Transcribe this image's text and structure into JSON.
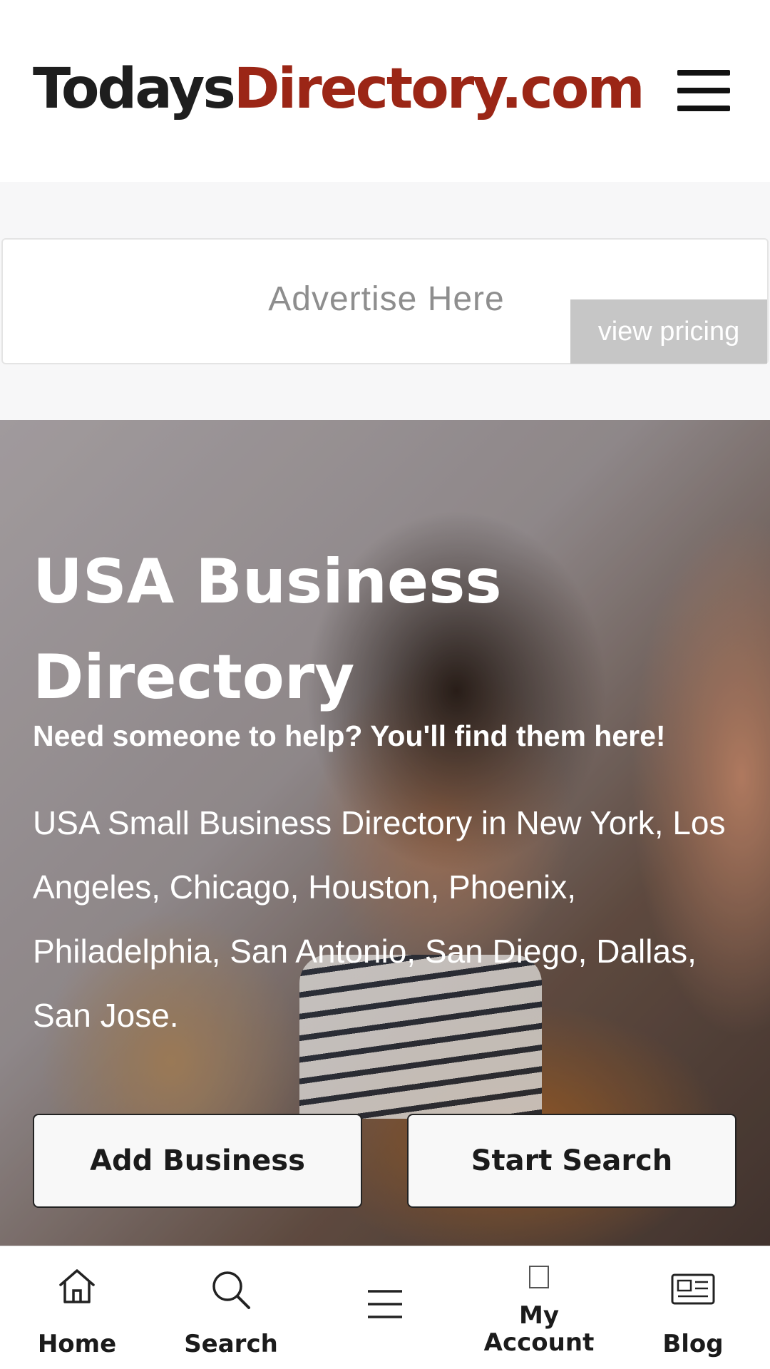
{
  "header": {
    "logo_part1": "Todays",
    "logo_part2": "Directory.com",
    "menu_icon": "hamburger-menu-icon",
    "colors": {
      "logo_dark": "#1e1e1e",
      "logo_accent": "#9b2616"
    }
  },
  "ad": {
    "text": "Advertise Here",
    "pricing_label": "view pricing"
  },
  "hero": {
    "title": "USA Business Directory",
    "subtitle": "Need someone to help? You'll find them here!",
    "description": "USA Small Business Directory in New York, Los Angeles, Chicago, Houston, Phoenix, Philadelphia, San Antonio, San Diego, Dallas, San Jose.",
    "add_business_label": "Add Business",
    "start_search_label": "Start Search"
  },
  "bottom_nav": {
    "items": [
      {
        "label": "Home",
        "icon": "home-icon"
      },
      {
        "label": "Search",
        "icon": "search-icon"
      },
      {
        "label": "",
        "icon": "menu-icon"
      },
      {
        "label": "My Account",
        "icon": "account-icon"
      },
      {
        "label": "Blog",
        "icon": "newspaper-icon"
      }
    ]
  }
}
